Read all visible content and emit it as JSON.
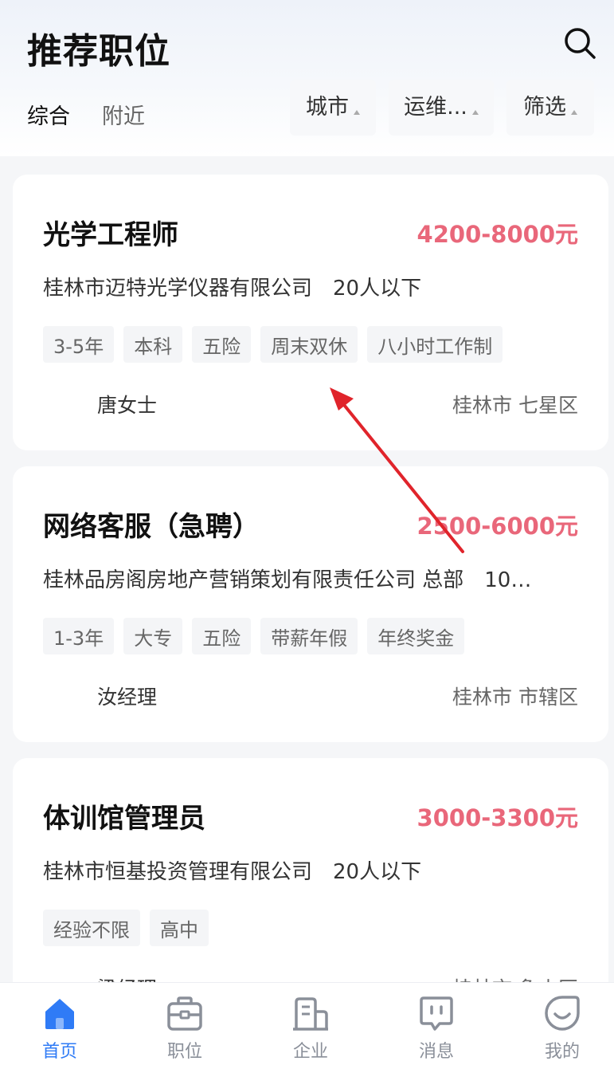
{
  "header": {
    "title": "推荐职位",
    "tabs": [
      "综合",
      "附近"
    ],
    "filters": {
      "city": "城市",
      "category": "运维...",
      "filter": "筛选"
    }
  },
  "jobs": [
    {
      "title": "光学工程师",
      "salary": "4200-8000元",
      "company": "桂林市迈特光学仪器有限公司",
      "size": "20人以下",
      "tags": [
        "3-5年",
        "本科",
        "五险",
        "周末双休",
        "八小时工作制"
      ],
      "contact": "唐女士",
      "location": "桂林市 七星区"
    },
    {
      "title": "网络客服（急聘）",
      "salary": "2500-6000元",
      "company": "桂林品房阁房地产营销策划有限责任公司 总部",
      "size": "10…",
      "tags": [
        "1-3年",
        "大专",
        "五险",
        "带薪年假",
        "年终奖金"
      ],
      "contact": "汝经理",
      "location": "桂林市 市辖区"
    },
    {
      "title": "体训馆管理员",
      "salary": "3000-3300元",
      "company": "桂林市恒基投资管理有限公司",
      "size": "20人以下",
      "tags": [
        "经验不限",
        "高中"
      ],
      "contact": "梁经理",
      "location": "桂林市 象山区"
    }
  ],
  "tabbar": {
    "items": [
      "首页",
      "职位",
      "企业",
      "消息",
      "我的"
    ],
    "active": "首页"
  },
  "colors": {
    "salary": "#e9677a",
    "accent": "#2f7bf6",
    "annotation_arrow": "#e0242b"
  },
  "icons": [
    "search-icon",
    "home-icon",
    "briefcase-icon",
    "building-icon",
    "message-icon",
    "profile-icon"
  ]
}
